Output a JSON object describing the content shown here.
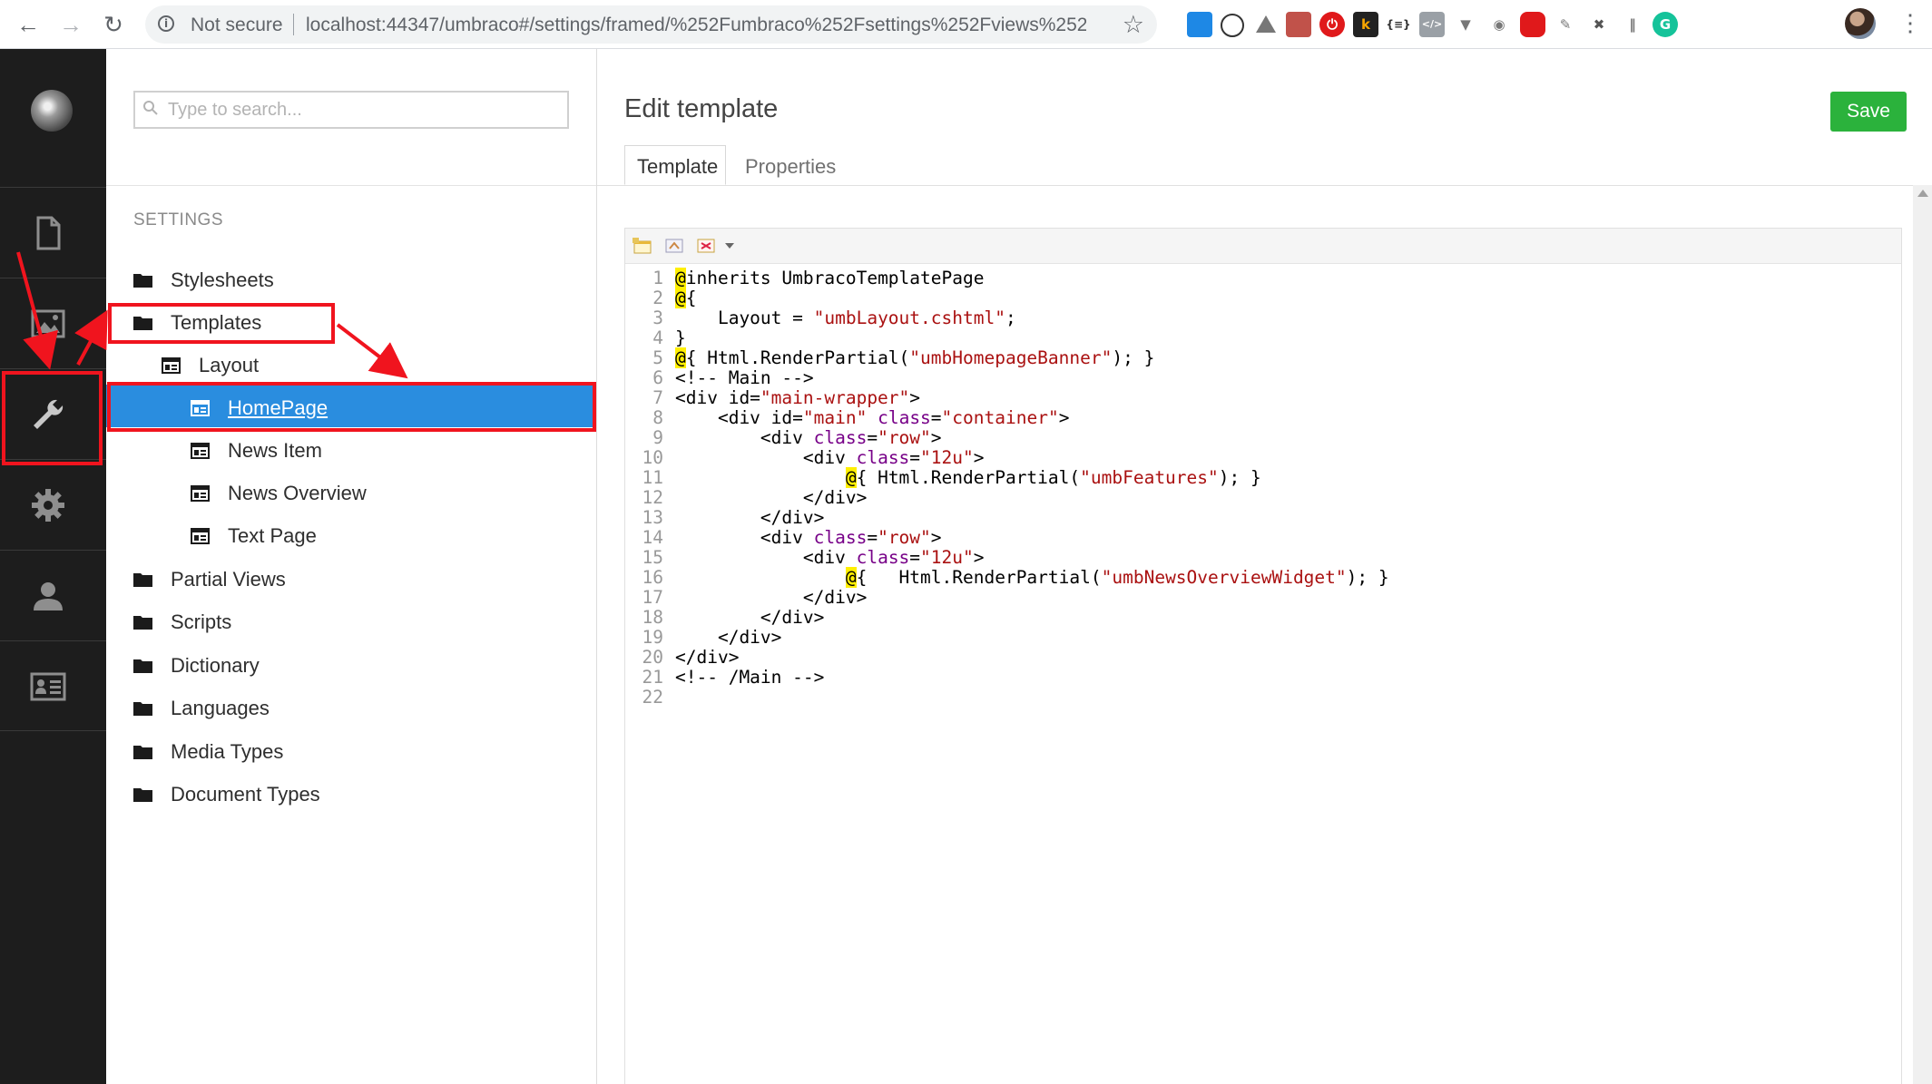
{
  "browser": {
    "security_label": "Not secure",
    "url": "localhost:44347/umbraco#/settings/framed/%252Fumbraco%252Fsettings%252Fviews%252F...",
    "extensions": [
      "k",
      "{≡}",
      "</>",
      "G"
    ]
  },
  "app_sidebar": {
    "sections": [
      {
        "name": "content",
        "icon": "document-icon"
      },
      {
        "name": "media",
        "icon": "image-icon"
      },
      {
        "name": "settings",
        "icon": "wrench-icon",
        "active": true
      },
      {
        "name": "developer",
        "icon": "gear-icon"
      },
      {
        "name": "users",
        "icon": "user-icon"
      },
      {
        "name": "members",
        "icon": "id-card-icon"
      }
    ]
  },
  "tree": {
    "search_placeholder": "Type to search...",
    "title": "SETTINGS",
    "items": [
      {
        "label": "Stylesheets",
        "icon": "folder-icon"
      },
      {
        "label": "Templates",
        "icon": "folder-icon"
      },
      {
        "label": "Layout",
        "icon": "template-icon"
      },
      {
        "label": "HomePage",
        "icon": "template-icon",
        "selected": true
      },
      {
        "label": "News Item",
        "icon": "template-icon"
      },
      {
        "label": "News Overview",
        "icon": "template-icon"
      },
      {
        "label": "Text Page",
        "icon": "template-icon"
      },
      {
        "label": "Partial Views",
        "icon": "folder-icon"
      },
      {
        "label": "Scripts",
        "icon": "folder-icon"
      },
      {
        "label": "Dictionary",
        "icon": "folder-icon"
      },
      {
        "label": "Languages",
        "icon": "folder-icon"
      },
      {
        "label": "Media Types",
        "icon": "folder-icon"
      },
      {
        "label": "Document Types",
        "icon": "folder-icon"
      }
    ]
  },
  "editor": {
    "title": "Edit template",
    "save_label": "Save",
    "tabs": [
      {
        "label": "Template",
        "active": true
      },
      {
        "label": "Properties",
        "active": false
      }
    ],
    "code_lines": [
      "@inherits UmbracoTemplatePage",
      "@{",
      "    Layout = \"umbLayout.cshtml\";",
      "}",
      "@{ Html.RenderPartial(\"umbHomepageBanner\"); }",
      "<!-- Main -->",
      "<div id=\"main-wrapper\">",
      "    <div id=\"main\" class=\"container\">",
      "        <div class=\"row\">",
      "            <div class=\"12u\">",
      "                @{ Html.RenderPartial(\"umbFeatures\"); }",
      "            </div>",
      "        </div>",
      "        <div class=\"row\">",
      "            <div class=\"12u\">",
      "                @{   Html.RenderPartial(\"umbNewsOverviewWidget\"); }",
      "            </div>",
      "        </div>",
      "    </div>",
      "</div>",
      "<!-- /Main -->",
      ""
    ]
  },
  "colors": {
    "sidebar_bg": "#1d1d1d",
    "selected_row": "#2a8ddf",
    "save_button": "#2bb23c",
    "annotation_red": "#f0141e"
  }
}
